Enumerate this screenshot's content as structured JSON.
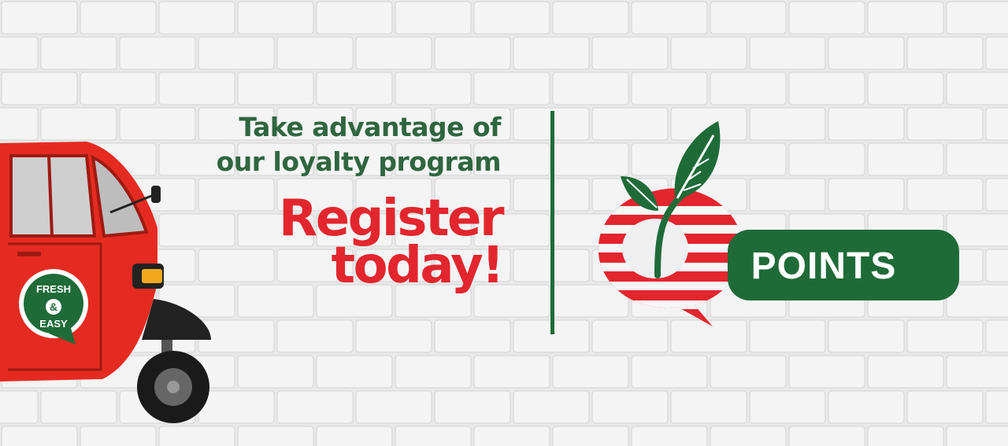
{
  "banner": {
    "tagline_line1": "Take advantage of",
    "tagline_line2": "our loyalty program",
    "cta_line1": "Register",
    "cta_line2": "today!"
  },
  "logo": {
    "label": "POINTS",
    "icon": "leaf-sprout-icon"
  },
  "rickshaw": {
    "badge_top": "FRESH",
    "badge_mid": "&",
    "badge_bottom": "EASY"
  },
  "colors": {
    "brand_green": "#2f6640",
    "brand_red": "#e3262e",
    "wall": "#ececec"
  }
}
